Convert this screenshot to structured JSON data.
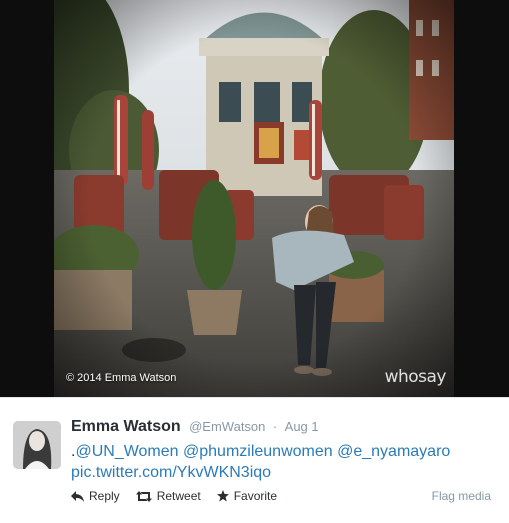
{
  "photo": {
    "credit": "© 2014 Emma Watson",
    "logo": "whosay"
  },
  "tweet": {
    "user_name": "Emma Watson",
    "handle": "@EmWatson",
    "separator": "·",
    "time": "Aug 1",
    "text_lead": ".",
    "mention_1": "@UN_Women",
    "mention_2": "@phumzileunwomen",
    "mention_3": "@e_nyamayaro",
    "media_link": "pic.twitter.com/YkvWKN3iqo",
    "actions": {
      "reply": "Reply",
      "retweet": "Retweet",
      "favorite": "Favorite",
      "flag": "Flag media"
    }
  },
  "colors": {
    "link": "#2b7bb9",
    "text": "#292f33",
    "muted": "#8899a6"
  }
}
